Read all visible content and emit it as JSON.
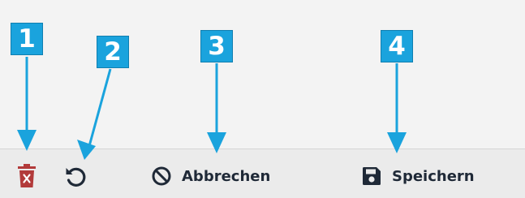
{
  "colors": {
    "annotation": "#1aa3dd",
    "delete_icon": "#b23a3a",
    "icon_dark": "#1f2937"
  },
  "toolbar": {
    "delete": {
      "icon": "trash-x-icon"
    },
    "reset": {
      "icon": "undo-icon"
    },
    "cancel": {
      "icon": "ban-icon",
      "label": "Abbrechen"
    },
    "save": {
      "icon": "floppy-disk-icon",
      "label": "Speichern"
    }
  },
  "callouts": [
    {
      "number": "1"
    },
    {
      "number": "2"
    },
    {
      "number": "3"
    },
    {
      "number": "4"
    }
  ]
}
